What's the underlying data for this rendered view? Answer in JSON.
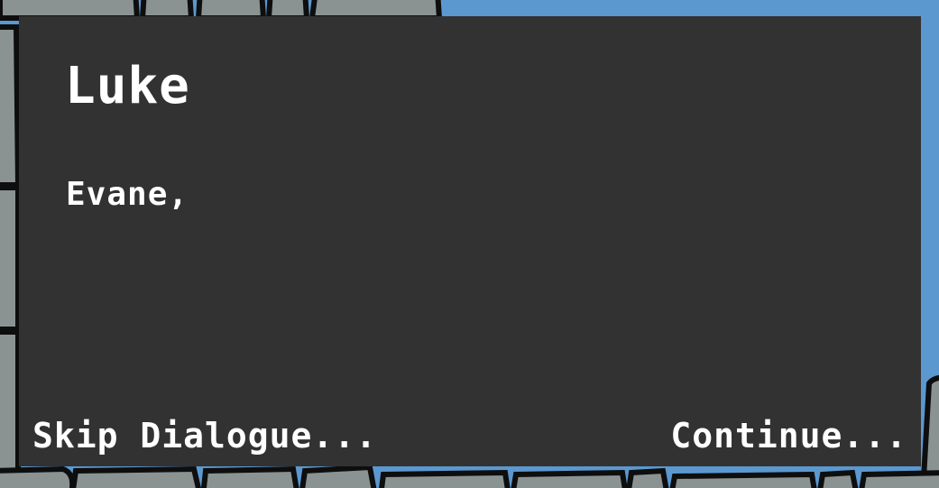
{
  "dialogue": {
    "speaker": "Luke",
    "text": "Evane,"
  },
  "controls": {
    "skip_label": "Skip Dialogue...",
    "continue_label": "Continue..."
  },
  "colors": {
    "sky": "#5b98d0",
    "stone": "#8a9392",
    "outline": "#0e0e0e",
    "panel": "#323232",
    "text": "#ffffff"
  }
}
